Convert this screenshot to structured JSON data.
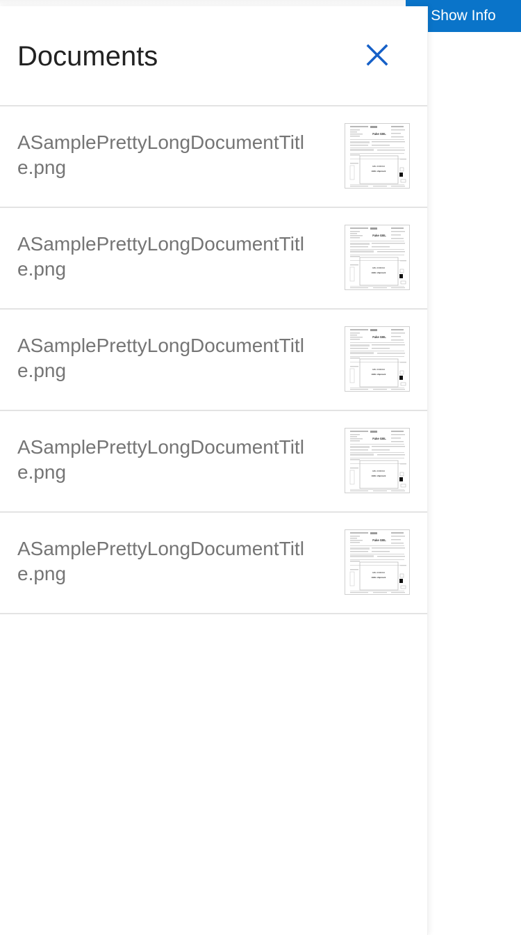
{
  "header": {
    "show_info_label": "Show Info"
  },
  "panel": {
    "title": "Documents",
    "close_icon": "close-icon"
  },
  "documents": [
    {
      "name": "ASamplePrettyLongDocumentTitle.png",
      "thumb_title": "Fake GBL",
      "thumb_id": "GBL 0000010",
      "thumb_status": "HHG shipment"
    },
    {
      "name": "ASamplePrettyLongDocumentTitle.png",
      "thumb_title": "Fake GBL",
      "thumb_id": "GBL 0000010",
      "thumb_status": "HHG shipment"
    },
    {
      "name": "ASamplePrettyLongDocumentTitle.png",
      "thumb_title": "Fake GBL",
      "thumb_id": "GBL 0000010",
      "thumb_status": "HHG shipment"
    },
    {
      "name": "ASamplePrettyLongDocumentTitle.png",
      "thumb_title": "Fake GBL",
      "thumb_id": "GBL 0000010",
      "thumb_status": "HHG shipment"
    },
    {
      "name": "ASamplePrettyLongDocumentTitle.png",
      "thumb_title": "Fake GBL",
      "thumb_id": "GBL 0000010",
      "thumb_status": "HHG shipment"
    }
  ],
  "colors": {
    "accent": "#0a74c9",
    "close_icon": "#1660c7",
    "divider": "#e3e3e3",
    "doc_text": "#757575"
  }
}
